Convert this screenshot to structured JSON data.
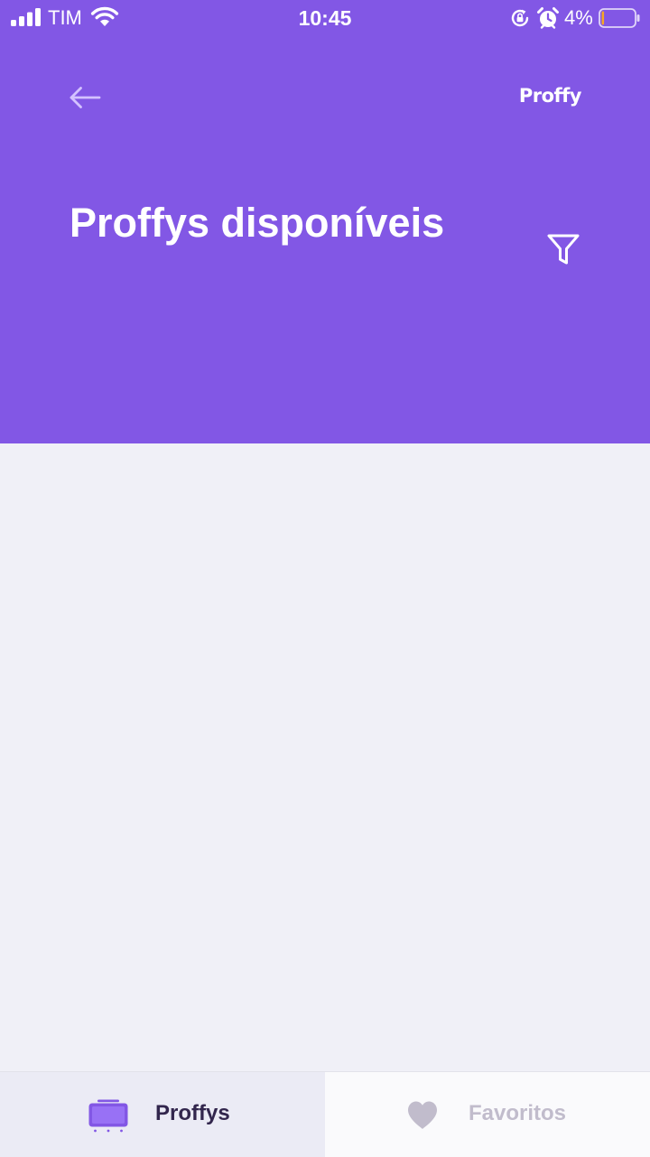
{
  "status_bar": {
    "carrier": "TIM",
    "time": "10:45",
    "battery_percent": "4%",
    "icons": [
      "signal-icon",
      "wifi-icon",
      "rotation-lock-icon",
      "alarm-icon",
      "battery-icon"
    ]
  },
  "header": {
    "back_icon": "arrow-left-icon",
    "logo": "Proffy",
    "title": "Proffys disponíveis",
    "filter_icon": "filter-icon"
  },
  "colors": {
    "header_background": "#8257E5",
    "page_background": "#F0F0F7",
    "tab_active_background": "#EBEBF5",
    "tab_inactive_background": "#FAFAFC",
    "tab_active_text": "#32264D",
    "tab_inactive_text": "#C1BCCC",
    "battery_low": "#F5A623"
  },
  "tabs": [
    {
      "label": "Proffys",
      "icon": "tv-icon",
      "active": "true"
    },
    {
      "label": "Favoritos",
      "icon": "heart-icon",
      "active": "false"
    }
  ]
}
